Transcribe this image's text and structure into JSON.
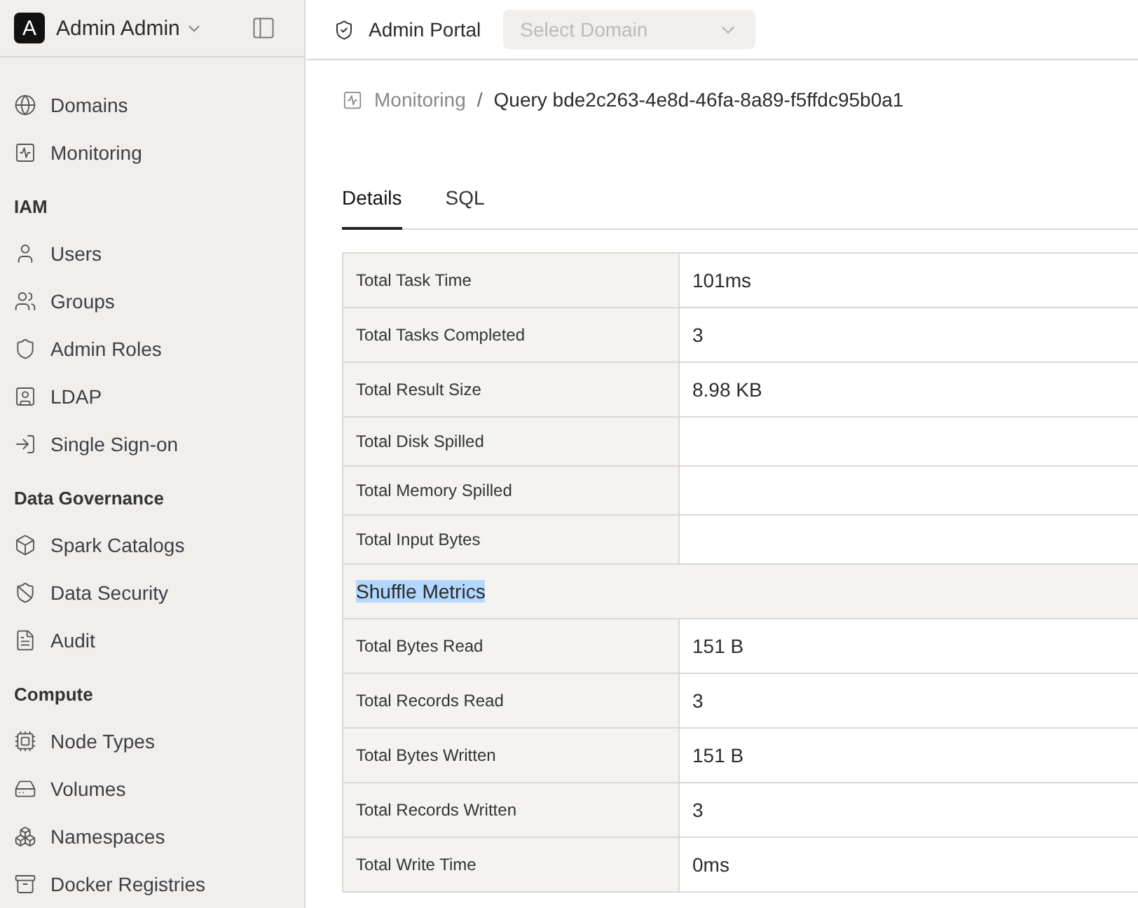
{
  "sidebar": {
    "account": {
      "avatar": "A",
      "name": "Admin Admin"
    },
    "sections": [
      {
        "items": [
          {
            "label": "Domains",
            "selected": false
          },
          {
            "label": "Monitoring",
            "selected": false
          }
        ]
      },
      {
        "title": "IAM",
        "items": [
          {
            "label": "Users",
            "selected": false
          },
          {
            "label": "Groups",
            "selected": false
          },
          {
            "label": "Admin Roles",
            "selected": false
          },
          {
            "label": "LDAP",
            "selected": false
          },
          {
            "label": "Single Sign-on",
            "selected": false
          }
        ]
      },
      {
        "title": "Data Governance",
        "items": [
          {
            "label": "Spark Catalogs",
            "selected": false
          },
          {
            "label": "Data Security",
            "selected": false
          },
          {
            "label": "Audit",
            "selected": false
          }
        ]
      },
      {
        "title": "Compute",
        "items": [
          {
            "label": "Node Types",
            "selected": false
          },
          {
            "label": "Volumes",
            "selected": false
          },
          {
            "label": "Namespaces",
            "selected": false
          },
          {
            "label": "Docker Registries",
            "selected": false
          }
        ]
      }
    ]
  },
  "header": {
    "title": "Admin Portal",
    "domain_select": {
      "placeholder": "Select Domain",
      "disabled": true
    }
  },
  "breadcrumb": {
    "separator": "/",
    "items": [
      "Monitoring",
      "Query bde2c263-4e8d-46fa-8a89-f5ffdc95b0a1"
    ]
  },
  "tabs": [
    {
      "label": "Details",
      "selected": true
    },
    {
      "label": "SQL",
      "selected": false
    }
  ],
  "table": {
    "rows": [
      {
        "kind": "metric",
        "label": "Total Task Time",
        "value": "101ms"
      },
      {
        "kind": "metric",
        "label": "Total Tasks Completed",
        "value": "3"
      },
      {
        "kind": "metric",
        "label": "Total Result Size",
        "value": "8.98 KB"
      },
      {
        "kind": "metric",
        "label": "Total Disk Spilled"
      },
      {
        "kind": "metric",
        "label": "Total Memory Spilled"
      },
      {
        "kind": "metric",
        "label": "Total Input Bytes"
      },
      {
        "kind": "section",
        "label": "Shuffle Metrics",
        "highlighted": true
      },
      {
        "kind": "metric",
        "label": "Total Bytes Read",
        "value": "151 B"
      },
      {
        "kind": "metric",
        "label": "Total Records Read",
        "value": "3"
      },
      {
        "kind": "metric",
        "label": "Total Bytes Written",
        "value": "151 B"
      },
      {
        "kind": "metric",
        "label": "Total Records Written",
        "value": "3"
      },
      {
        "kind": "metric",
        "label": "Total Write Time",
        "value": "0ms"
      }
    ]
  }
}
